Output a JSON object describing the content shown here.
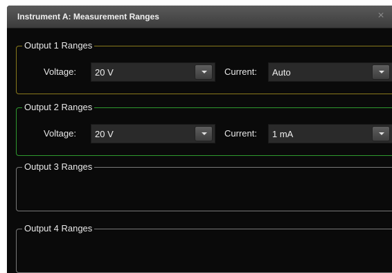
{
  "window": {
    "title": "Instrument A: Measurement Ranges",
    "close_glyph": "×"
  },
  "groups": [
    {
      "legend": "Output 1 Ranges",
      "voltage_label": "Voltage:",
      "voltage_value": "20 V",
      "current_label": "Current:",
      "current_value": "Auto",
      "border_color": "#8a7a1c"
    },
    {
      "legend": "Output 2 Ranges",
      "voltage_label": "Voltage:",
      "voltage_value": "20 V",
      "current_label": "Current:",
      "current_value": "1 mA",
      "border_color": "#2f9a2f"
    },
    {
      "legend": "Output 3 Ranges",
      "border_color": "#7a7a7a"
    },
    {
      "legend": "Output 4 Ranges",
      "border_color": "#7a7a7a"
    }
  ],
  "icons": {
    "close": "close-icon",
    "dropdown": "chevron-down-icon"
  }
}
